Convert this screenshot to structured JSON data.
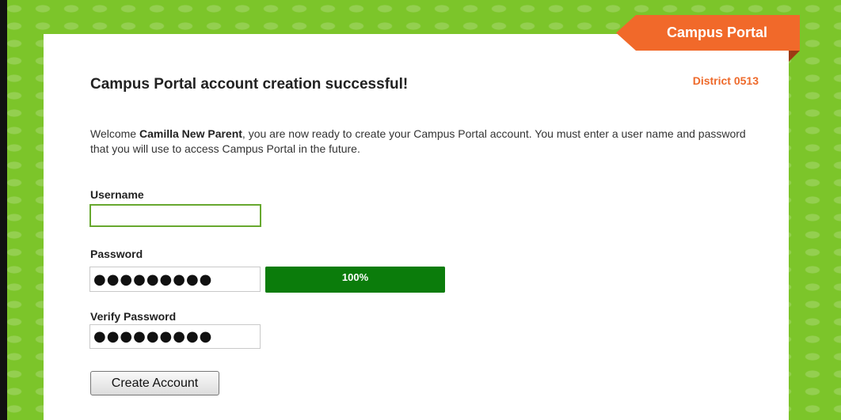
{
  "header": {
    "brand": "Campus Portal",
    "district": "District 0513"
  },
  "page": {
    "title": "Campus Portal account creation successful!",
    "welcome_prefix": "Welcome ",
    "user_name": "Camilla New Parent",
    "welcome_suffix": ", you are now ready to create your Campus Portal account. You must enter a user name and password that you will use to access Campus Portal in the future."
  },
  "form": {
    "username_label": "Username",
    "username_value": "",
    "password_label": "Password",
    "password_value": "●●●●●●●●●",
    "password_strength": 100,
    "password_strength_text": "100%",
    "verify_label": "Verify Password",
    "verify_value": "●●●●●●●●●",
    "create_button": "Create Account"
  },
  "colors": {
    "background": "#7cc52a",
    "ribbon": "#f1692a",
    "district_text": "#ee6a2b",
    "strength_bar": "#0b7c0b",
    "username_focus_border": "#67a82f"
  }
}
